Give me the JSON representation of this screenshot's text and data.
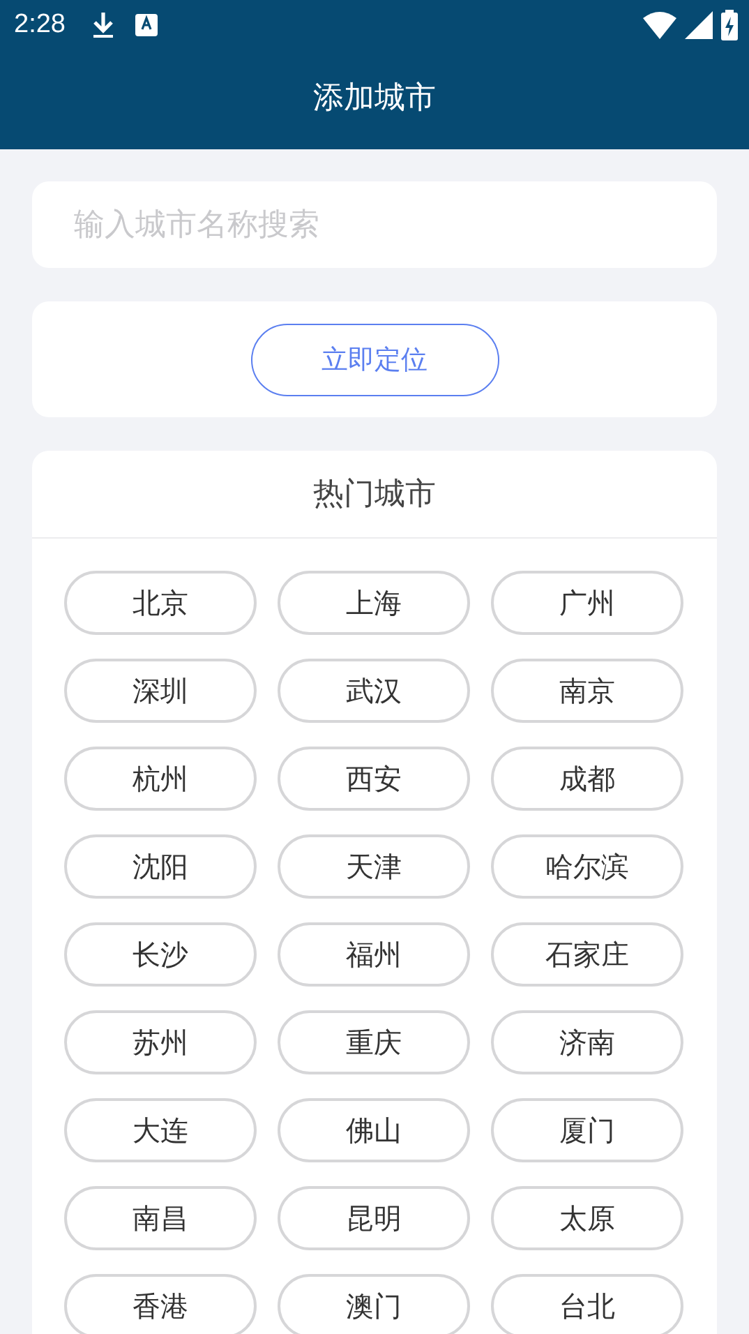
{
  "status_bar": {
    "time": "2:28"
  },
  "header": {
    "title": "添加城市"
  },
  "search": {
    "placeholder": "输入城市名称搜索"
  },
  "locate_button": {
    "label": "立即定位"
  },
  "hot_cities": {
    "title": "热门城市",
    "cities": [
      {
        "name": "北京"
      },
      {
        "name": "上海"
      },
      {
        "name": "广州"
      },
      {
        "name": "深圳"
      },
      {
        "name": "武汉"
      },
      {
        "name": "南京"
      },
      {
        "name": "杭州"
      },
      {
        "name": "西安"
      },
      {
        "name": "成都"
      },
      {
        "name": "沈阳"
      },
      {
        "name": "天津"
      },
      {
        "name": "哈尔滨"
      },
      {
        "name": "长沙"
      },
      {
        "name": "福州"
      },
      {
        "name": "石家庄"
      },
      {
        "name": "苏州"
      },
      {
        "name": "重庆"
      },
      {
        "name": "济南"
      },
      {
        "name": "大连"
      },
      {
        "name": "佛山"
      },
      {
        "name": "厦门"
      },
      {
        "name": "南昌"
      },
      {
        "name": "昆明"
      },
      {
        "name": "太原"
      },
      {
        "name": "香港"
      },
      {
        "name": "澳门"
      },
      {
        "name": "台北"
      }
    ]
  }
}
